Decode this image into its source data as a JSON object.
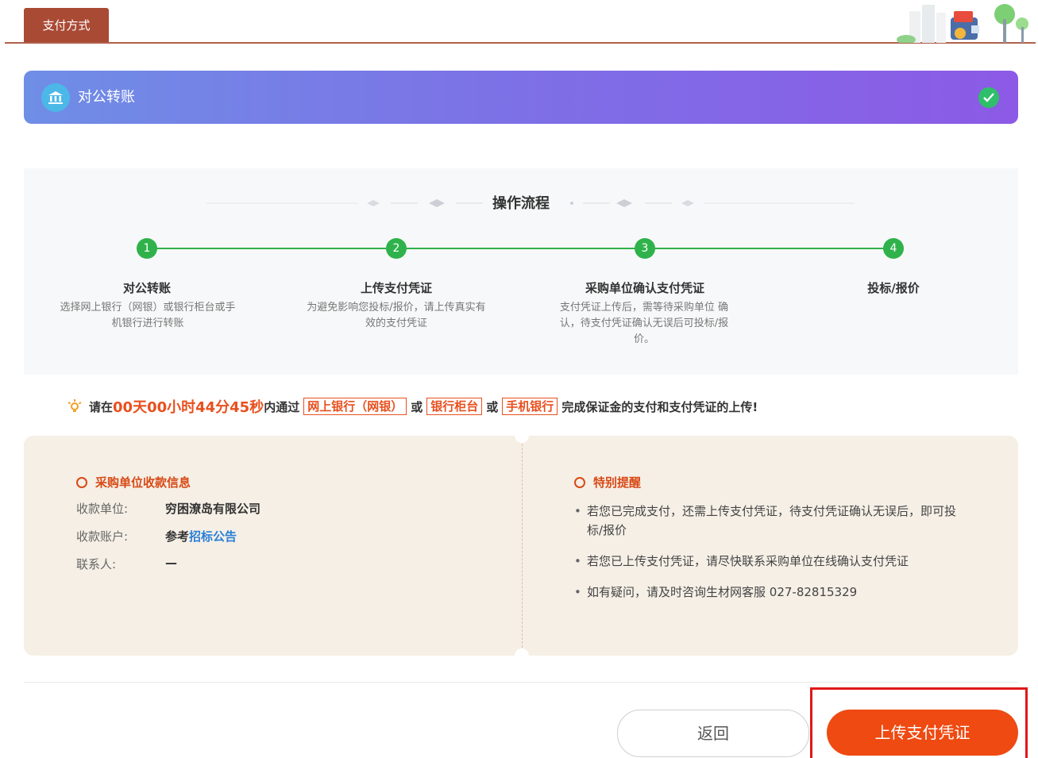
{
  "tab": {
    "label": "支付方式"
  },
  "banner": {
    "title": "对公转账"
  },
  "flow": {
    "title": "操作流程",
    "steps": [
      {
        "num": "1",
        "title": "对公转账",
        "desc": "选择网上银行（网银）或银行柜台或手机银行进行转账"
      },
      {
        "num": "2",
        "title": "上传支付凭证",
        "desc": "为避免影响您投标/报价，请上传真实有效的支付凭证"
      },
      {
        "num": "3",
        "title": "采购单位确认支付凭证",
        "desc": "支付凭证上传后，需等待采购单位 确认，待支付凭证确认无误后可投标/报价。"
      },
      {
        "num": "4",
        "title": "投标/报价",
        "desc": ""
      }
    ]
  },
  "notice": {
    "prefix": "请在",
    "time": "00天00小时44分45秒",
    "mid": "内通过",
    "opt1": "网上银行（网银）",
    "or1": "或",
    "opt2": "银行柜台",
    "or2": "或",
    "opt3": "手机银行",
    "suffix": "完成保证金的支付和支付凭证的上传!"
  },
  "receiver": {
    "title": "采购单位收款信息",
    "unit_label": "收款单位:",
    "unit_value": "穷困潦岛有限公司",
    "account_label": "收款账户:",
    "account_prefix": "参考",
    "account_link": "招标公告",
    "contact_label": "联系人:",
    "contact_value": "—"
  },
  "reminder": {
    "title": "特别提醒",
    "items": [
      "若您已完成支付，还需上传支付凭证，待支付凭证确认无误后，即可投标/报价",
      "若您已上传支付凭证，请尽快联系采购单位在线确认支付凭证",
      "如有疑问，请及时咨询生材网客服 027-82815329"
    ]
  },
  "buttons": {
    "back": "返回",
    "upload": "上传支付凭证"
  },
  "colors": {
    "accent": "#ee4a12",
    "tab": "#a94a35",
    "step": "#2fb24b",
    "highlight": "#e01818"
  }
}
